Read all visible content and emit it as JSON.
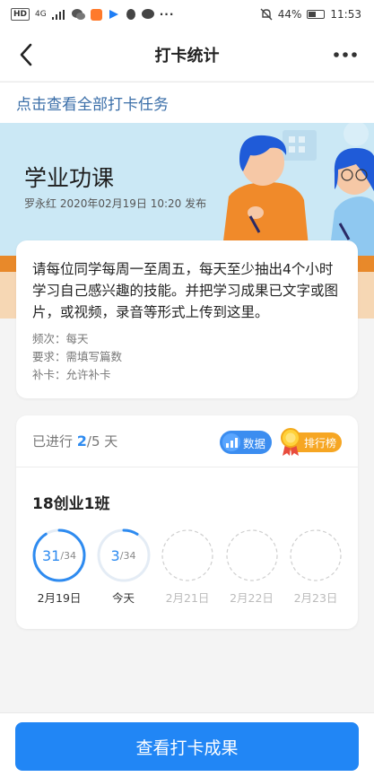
{
  "status_bar": {
    "hd": "HD",
    "network": "4G",
    "battery": "44%",
    "time": "11:53",
    "more": "···"
  },
  "nav": {
    "title": "打卡统计"
  },
  "all_tasks_link": "点击查看全部打卡任务",
  "banner": {
    "title": "学业功课",
    "meta": "罗永红  2020年02月19日 10:20 发布"
  },
  "description": {
    "text": "请每位同学每周一至周五，每天至少抽出4个小时学习自己感兴趣的技能。并把学习成果已文字或图片，或视频，录音等形式上传到这里。",
    "frequency": "频次：每天",
    "requirement": "要求：需填写篇数",
    "makeup": "补卡：允许补卡"
  },
  "progress": {
    "prefix": "已进行 ",
    "done": "2",
    "suffix": "/5 天",
    "data_label": "数据",
    "rank_label": "排行榜",
    "class_name": "18创业1班",
    "days": [
      {
        "count": "31",
        "total": "/34",
        "date": "2月19日",
        "fraction": 0.91,
        "state": "past"
      },
      {
        "count": "3",
        "total": "/34",
        "date": "今天",
        "fraction": 0.09,
        "state": "today"
      },
      {
        "count": "",
        "total": "",
        "date": "2月21日",
        "fraction": 0,
        "state": "future"
      },
      {
        "count": "",
        "total": "",
        "date": "2月22日",
        "fraction": 0,
        "state": "future"
      },
      {
        "count": "",
        "total": "",
        "date": "2月23日",
        "fraction": 0,
        "state": "future"
      }
    ]
  },
  "bottom_button": "查看打卡成果",
  "colors": {
    "accent": "#2186f5",
    "link": "#3a6ea8",
    "banner_bg": "#cbe8f5",
    "rank_orange": "#f6a623"
  },
  "icons": {
    "back": "chevron-left-icon",
    "more": "more-dots-icon",
    "data": "chart-icon",
    "rank": "medal-icon"
  }
}
